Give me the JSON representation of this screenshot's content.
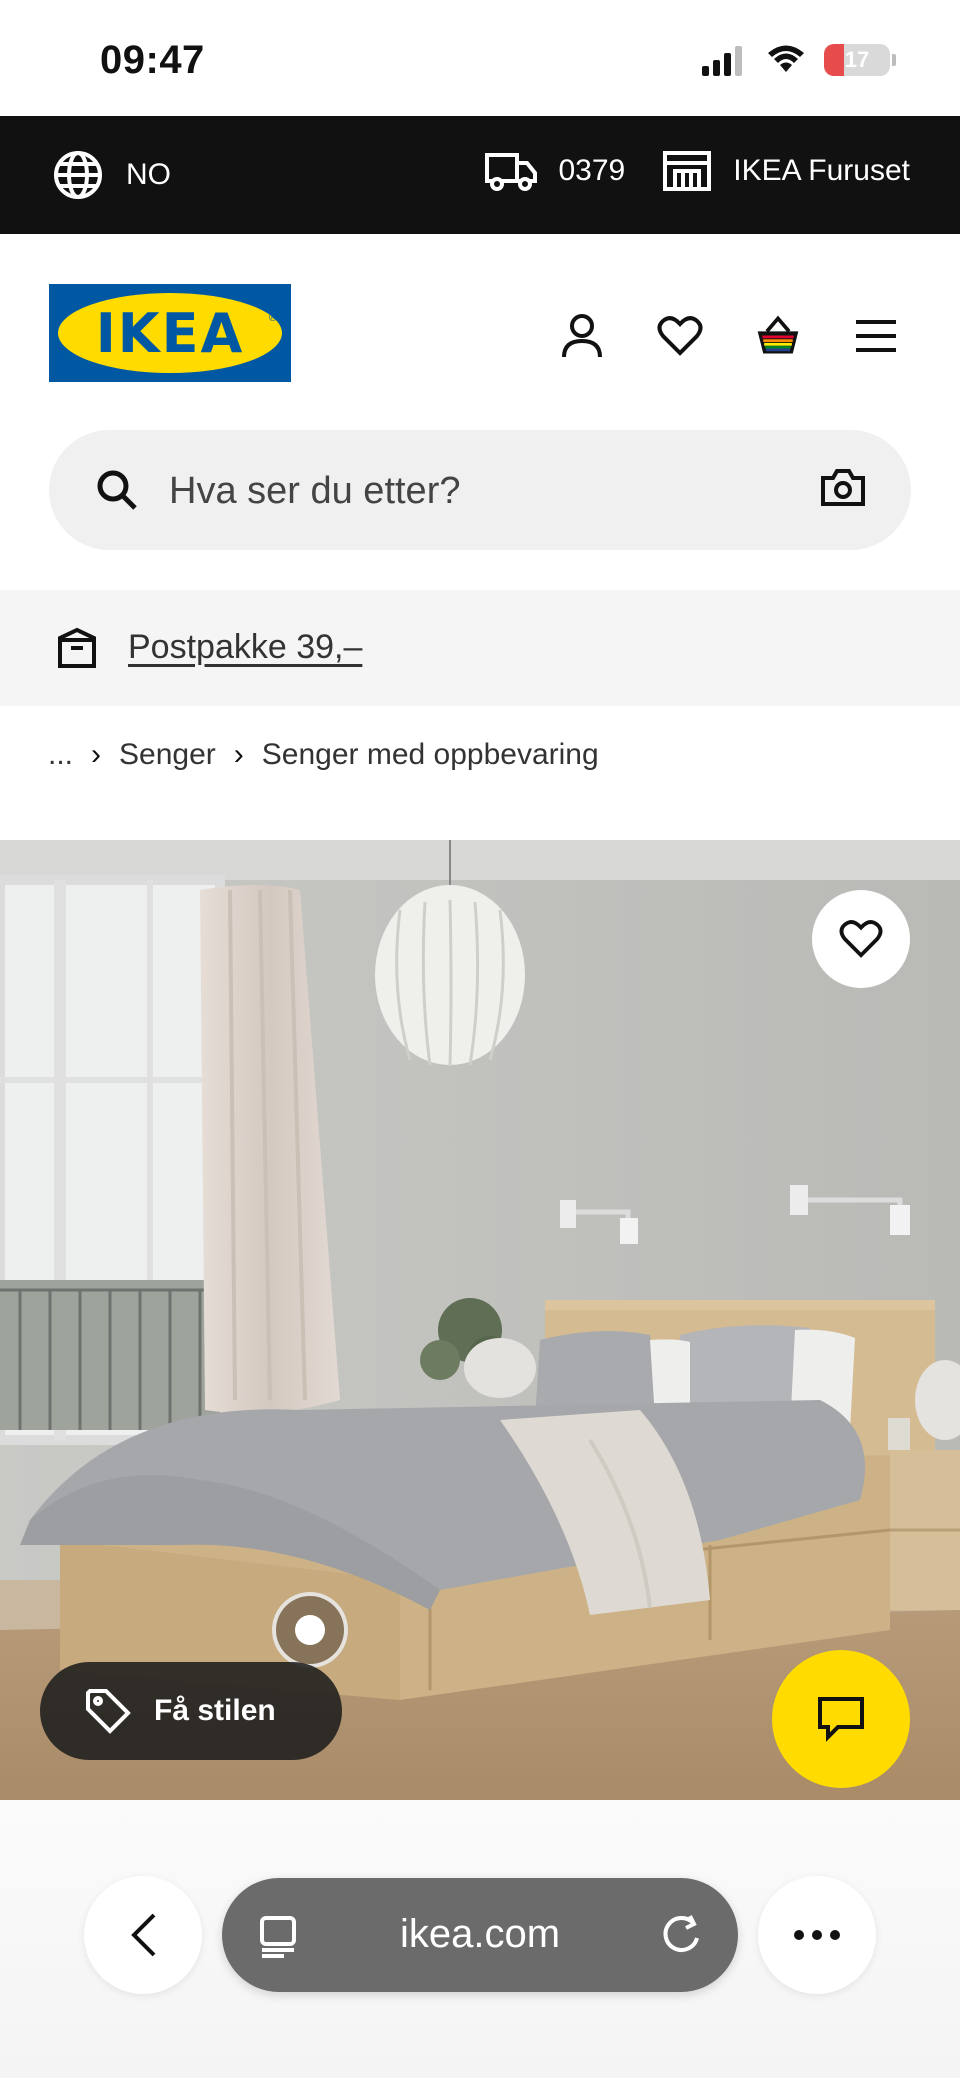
{
  "status_bar": {
    "time": "09:47",
    "battery": "17"
  },
  "topbar": {
    "language": "NO",
    "postcode": "0379",
    "store": "IKEA Furuset"
  },
  "header": {
    "logo_text": "IKEA"
  },
  "search": {
    "placeholder": "Hva ser du etter?"
  },
  "promo": {
    "text": "Postpakke 39,–"
  },
  "breadcrumb": {
    "ellipsis": "...",
    "items": [
      "Senger",
      "Senger med oppbevaring"
    ]
  },
  "product_image": {
    "style_button": "Få stilen"
  },
  "browser": {
    "url": "ikea.com"
  },
  "colors": {
    "ikea_blue": "#0058a3",
    "ikea_yellow": "#ffdb00",
    "topbar_bg": "#111111"
  }
}
